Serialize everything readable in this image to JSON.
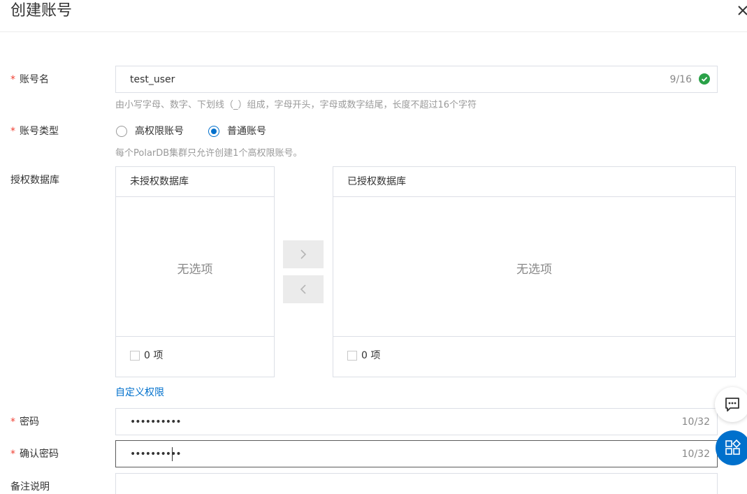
{
  "dialog": {
    "title": "创建账号"
  },
  "fields": {
    "account_name": {
      "required": "*",
      "label": "账号名",
      "value": "test_user",
      "count": "9/16",
      "hint": "由小写字母、数字、下划线（_）组成，字母开头，字母或数字结尾，长度不超过16个字符"
    },
    "account_type": {
      "required": "*",
      "label": "账号类型",
      "options": [
        "高权限账号",
        "普通账号"
      ],
      "selected": "普通账号",
      "hint": "每个PolarDB集群只允许创建1个高权限账号。"
    },
    "databases": {
      "label": "授权数据库",
      "left_title": "未授权数据库",
      "right_title": "已授权数据库",
      "empty_text": "无选项",
      "left_count": "0 项",
      "right_count": "0 项",
      "custom_link": "自定义权限"
    },
    "password": {
      "required": "*",
      "label": "密码",
      "masked_value": "••••••••••",
      "count": "10/32"
    },
    "confirm_password": {
      "required": "*",
      "label": "确认密码",
      "masked_value": "••••••••••",
      "count": "10/32"
    },
    "remark": {
      "label": "备注说明"
    }
  },
  "colors": {
    "primary": "#0070cc",
    "required": "#f04134",
    "success": "#2aa148"
  },
  "icons": {
    "close": "close-icon",
    "success": "check-circle-icon",
    "move_right": "chevron-right-icon",
    "move_left": "chevron-left-icon",
    "chat": "chat-icon",
    "apps": "apps-icon"
  }
}
